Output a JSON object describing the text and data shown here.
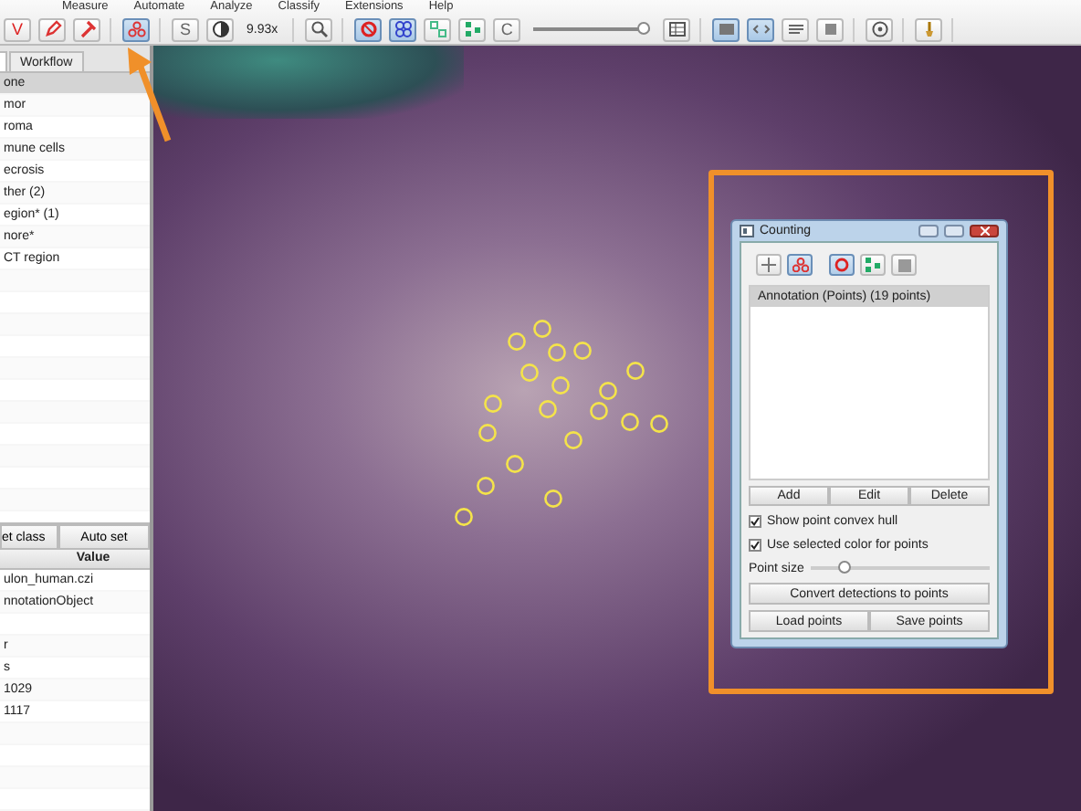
{
  "menu": [
    "Measure",
    "Automate",
    "Analyze",
    "Classify",
    "Extensions",
    "Help"
  ],
  "toolbar": [
    [
      {
        "kind": "letter",
        "label": "V",
        "selected": false
      },
      {
        "kind": "icon",
        "selected": false
      },
      {
        "kind": "icon",
        "selected": false
      }
    ],
    [
      {
        "kind": "icon",
        "selected": true
      }
    ],
    [
      {
        "kind": "letter",
        "label": "S",
        "selected": false
      },
      {
        "kind": "icon",
        "selected": false
      },
      {
        "kind": "readout",
        "label": "9.93x"
      }
    ],
    [
      {
        "kind": "icon",
        "selected": false
      }
    ],
    [
      {
        "kind": "icon",
        "selected": true
      },
      {
        "kind": "icon",
        "selected": true
      },
      {
        "kind": "icon",
        "selected": false
      },
      {
        "kind": "icon",
        "selected": false
      },
      {
        "kind": "letter",
        "label": "C",
        "selected": false
      },
      {
        "kind": "slider",
        "level": 0.95
      },
      {
        "kind": "icon",
        "selected": false
      }
    ],
    [
      {
        "kind": "icon",
        "selected": true
      },
      {
        "kind": "icon",
        "selected": true
      },
      {
        "kind": "icon",
        "selected": false
      },
      {
        "kind": "icon",
        "selected": false
      }
    ],
    [
      {
        "kind": "icon",
        "selected": false
      }
    ],
    [
      {
        "kind": "icon",
        "selected": false
      }
    ]
  ],
  "left_panel": {
    "tabs": [
      {
        "label": "Workflow",
        "selected": false
      }
    ],
    "classes": [
      {
        "label": "one",
        "selected": true
      },
      {
        "label": "mor",
        "selected": false
      },
      {
        "label": "roma",
        "selected": false
      },
      {
        "label": "mune cells",
        "selected": false
      },
      {
        "label": "ecrosis",
        "selected": false
      },
      {
        "label": "ther (2)",
        "selected": false
      },
      {
        "label": "egion* (1)",
        "selected": false
      },
      {
        "label": "nore*",
        "selected": false
      },
      {
        "label": "CT region",
        "selected": false
      }
    ],
    "buttons": [
      "et class",
      "Auto set"
    ],
    "table": {
      "columns": [
        "Value"
      ],
      "rows": [
        "ulon_human.czi",
        "nnotationObject",
        "",
        "r",
        "s",
        "1029",
        "1117"
      ]
    }
  },
  "counting_dialog": {
    "title": "Counting",
    "tools": [
      {
        "selected": false
      },
      {
        "selected": true
      },
      {
        "selected": true
      },
      {
        "selected": false
      },
      {
        "selected": false
      }
    ],
    "list": [
      {
        "label": "Annotation (Points) (19 points)",
        "selected": true
      }
    ],
    "list_buttons": [
      "Add",
      "Edit",
      "Delete"
    ],
    "checkboxes": [
      {
        "label": "Show point convex hull",
        "checked": true
      },
      {
        "label": "Use selected color for points",
        "checked": true
      }
    ],
    "point_size": {
      "label": "Point size",
      "level": 0.18
    },
    "convert_button": "Convert detections to points",
    "file_buttons": [
      "Load points",
      "Save points"
    ]
  }
}
